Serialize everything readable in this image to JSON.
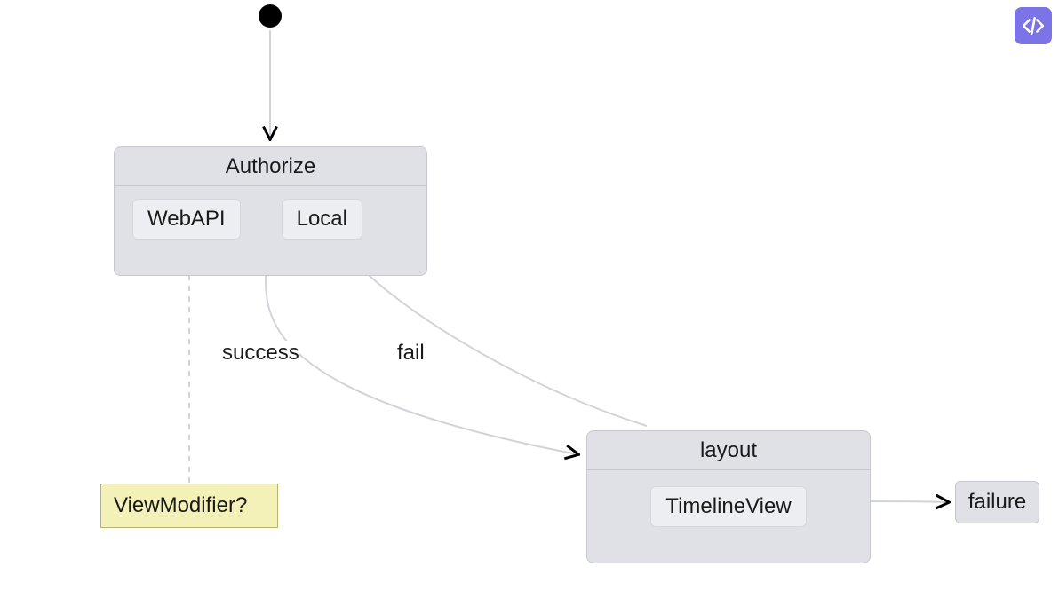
{
  "nodes": {
    "authorize": {
      "title": "Authorize",
      "children": {
        "webapi": "WebAPI",
        "local": "Local"
      }
    },
    "viewmodifier": {
      "label": "ViewModifier?"
    },
    "layout": {
      "title": "layout",
      "children": {
        "timelineview": "TimelineView"
      }
    },
    "failure": {
      "label": "failure"
    }
  },
  "edges": {
    "success": {
      "label": "success"
    },
    "fail": {
      "label": "fail"
    }
  },
  "buttons": {
    "code_toggle": "code"
  },
  "colors": {
    "node_bg": "#e0e1e6",
    "node_border": "#c8c9cf",
    "subnode_bg": "#eceef1",
    "note_bg": "#f3f0b8",
    "note_border": "#b8b46a",
    "edge": "#d3d4d9",
    "arrow": "#000000",
    "accent": "#7c73e6"
  }
}
